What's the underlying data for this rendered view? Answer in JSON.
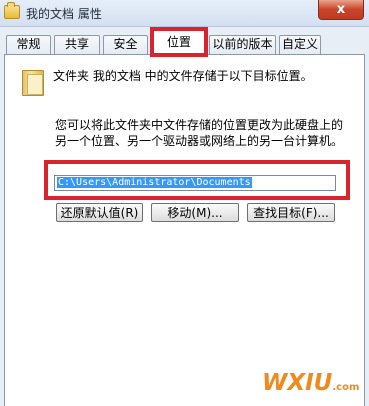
{
  "window": {
    "title": "我的文档 属性",
    "close_glyph": "x"
  },
  "tabs": [
    "常规",
    "共享",
    "安全",
    "位置",
    "以前的版本",
    "自定义"
  ],
  "active_tab": "位置",
  "panel": {
    "description": "文件夹 我的文档 中的文件存储于以下目标位置。",
    "instructions": "您可以将此文件夹中文件存储的位置更改为此硬盘上的另一个位置、另一个驱动器或网络上的另一台计算机。",
    "path_value": "C:\\Users\\Administrator\\Documents"
  },
  "buttons": {
    "restore_default": "还原默认值(R)",
    "move": "移动(M)...",
    "find_target": "查找目标(F)..."
  },
  "watermark": {
    "text": "WXIU",
    "suffix": ".com"
  },
  "colors": {
    "highlight": "#d9232d",
    "selection": "#3399ff",
    "watermark": "#f08a1c"
  }
}
